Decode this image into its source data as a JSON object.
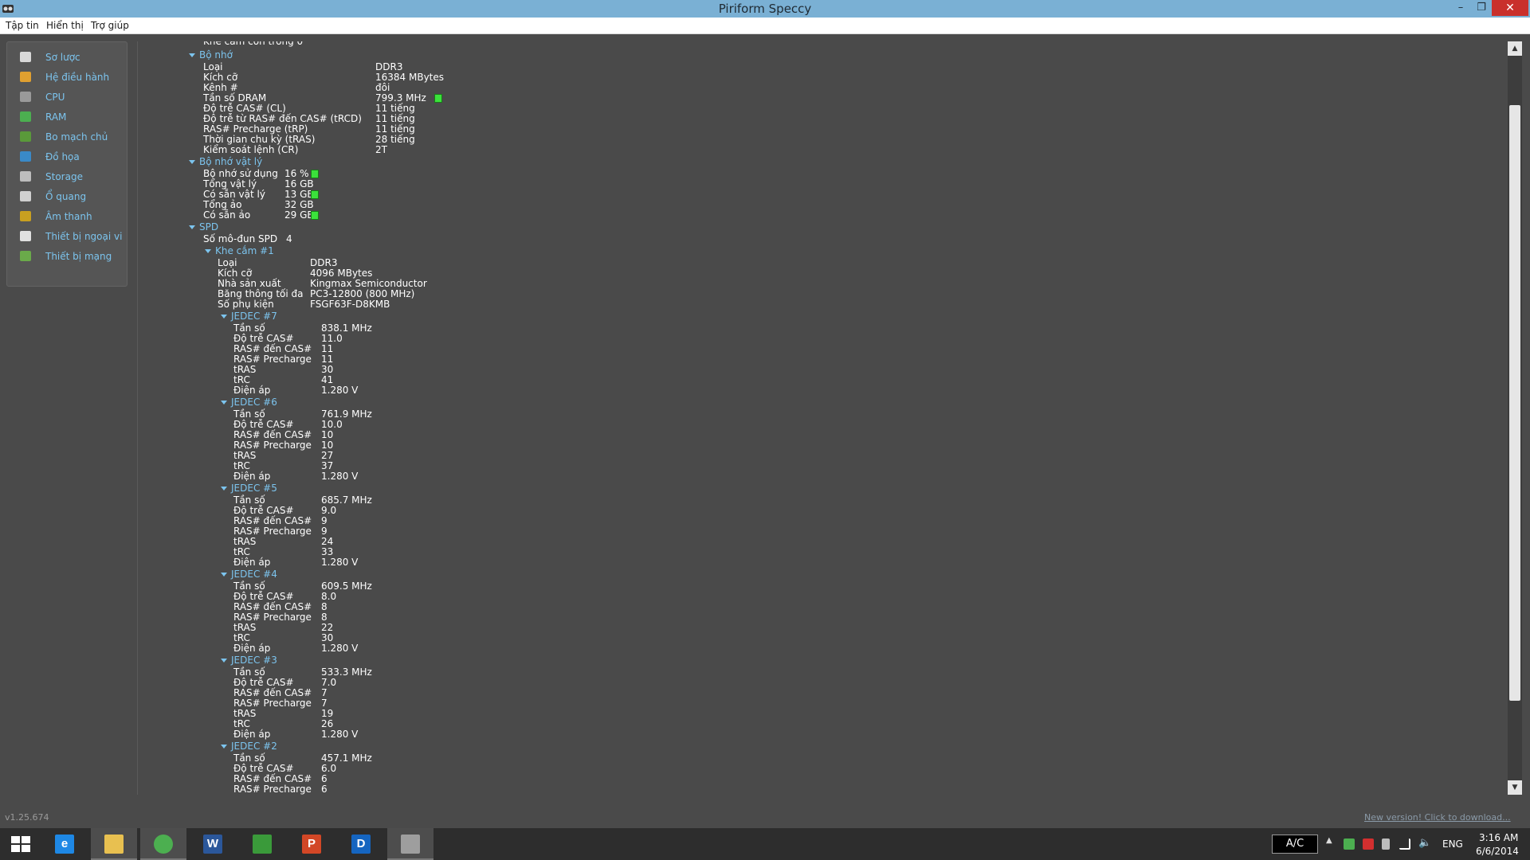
{
  "window": {
    "title": "Piriform Speccy",
    "minimize": "–",
    "maximize": "❐",
    "close": "✕"
  },
  "menu": [
    "Tập tin",
    "Hiển thị",
    "Trợ giúp"
  ],
  "sidebar": [
    {
      "label": "Sơ lược",
      "icon": "summary-icon",
      "color": "#d8d8d8"
    },
    {
      "label": "Hệ điều hành",
      "icon": "windows-icon",
      "color": "#e0a030"
    },
    {
      "label": "CPU",
      "icon": "cpu-icon",
      "color": "#9a9a9a"
    },
    {
      "label": "RAM",
      "icon": "ram-icon",
      "color": "#4caf50"
    },
    {
      "label": "Bo mạch chủ",
      "icon": "motherboard-icon",
      "color": "#5a9a3a"
    },
    {
      "label": "Đồ họa",
      "icon": "graphics-icon",
      "color": "#3a8ac8"
    },
    {
      "label": "Storage",
      "icon": "storage-icon",
      "color": "#bdbdbd"
    },
    {
      "label": "Ổ quang",
      "icon": "optical-drive-icon",
      "color": "#d0d0d0"
    },
    {
      "label": "Âm thanh",
      "icon": "audio-icon",
      "color": "#c8a020"
    },
    {
      "label": "Thiết bị ngoại vi",
      "icon": "peripheral-icon",
      "color": "#e0e0e0"
    },
    {
      "label": "Thiết bị mạng",
      "icon": "network-icon",
      "color": "#6aaa4a"
    }
  ],
  "content": {
    "cut_top": "Khe cắm còn trống   0",
    "memory": {
      "header": "Bộ nhớ",
      "rows": [
        {
          "k": "Loại",
          "v": "DDR3"
        },
        {
          "k": "Kích cỡ",
          "v": "16384 MBytes"
        },
        {
          "k": "Kênh #",
          "v": "đôi"
        },
        {
          "k": "Tần số DRAM",
          "v": "799.3 MHz",
          "ind": true
        },
        {
          "k": "Độ trễ CAS# (CL)",
          "v": "11 tiếng"
        },
        {
          "k": "Độ trễ từ RAS# đến CAS# (tRCD)",
          "v": "11 tiếng"
        },
        {
          "k": "RAS# Precharge (tRP)",
          "v": "11 tiếng"
        },
        {
          "k": "Thời gian chu kỳ (tRAS)",
          "v": "28 tiếng"
        },
        {
          "k": "Kiểm soát lệnh (CR)",
          "v": "2T"
        }
      ]
    },
    "physical": {
      "header": "Bộ nhớ vật lý",
      "rows": [
        {
          "k": "Bộ nhớ sử dụng",
          "v": "16 %",
          "ind": true
        },
        {
          "k": "Tổng vật lý",
          "v": "16 GB"
        },
        {
          "k": "Có sẵn vật lý",
          "v": "13 GB",
          "ind": true
        },
        {
          "k": "Tổng ảo",
          "v": "32 GB"
        },
        {
          "k": "Có sẵn ảo",
          "v": "29 GB",
          "ind": true
        }
      ]
    },
    "spd": {
      "header": "SPD",
      "count_label": "Số mô-đun SPD",
      "count_value": "4",
      "slot": {
        "header": "Khe cắm #1",
        "rows": [
          {
            "k": "Loại",
            "v": "DDR3"
          },
          {
            "k": "Kích cỡ",
            "v": "4096 MBytes"
          },
          {
            "k": "Nhà sản xuất",
            "v": "Kingmax Semiconductor"
          },
          {
            "k": "Băng thông tối đa",
            "v": "PC3-12800 (800 MHz)"
          },
          {
            "k": "Số phụ kiện",
            "v": "FSGF63F-D8KMB"
          }
        ],
        "jedec": [
          {
            "header": "JEDEC #7",
            "rows": [
              {
                "k": "Tần số",
                "v": "838.1 MHz"
              },
              {
                "k": "Độ trễ CAS#",
                "v": "11.0"
              },
              {
                "k": "RAS# đến CAS#",
                "v": "11"
              },
              {
                "k": "RAS# Precharge",
                "v": "11"
              },
              {
                "k": "tRAS",
                "v": "30"
              },
              {
                "k": "tRC",
                "v": "41"
              },
              {
                "k": "Điện áp",
                "v": "1.280 V"
              }
            ]
          },
          {
            "header": "JEDEC #6",
            "rows": [
              {
                "k": "Tần số",
                "v": "761.9 MHz"
              },
              {
                "k": "Độ trễ CAS#",
                "v": "10.0"
              },
              {
                "k": "RAS# đến CAS#",
                "v": "10"
              },
              {
                "k": "RAS# Precharge",
                "v": "10"
              },
              {
                "k": "tRAS",
                "v": "27"
              },
              {
                "k": "tRC",
                "v": "37"
              },
              {
                "k": "Điện áp",
                "v": "1.280 V"
              }
            ]
          },
          {
            "header": "JEDEC #5",
            "rows": [
              {
                "k": "Tần số",
                "v": "685.7 MHz"
              },
              {
                "k": "Độ trễ CAS#",
                "v": "9.0"
              },
              {
                "k": "RAS# đến CAS#",
                "v": "9"
              },
              {
                "k": "RAS# Precharge",
                "v": "9"
              },
              {
                "k": "tRAS",
                "v": "24"
              },
              {
                "k": "tRC",
                "v": "33"
              },
              {
                "k": "Điện áp",
                "v": "1.280 V"
              }
            ]
          },
          {
            "header": "JEDEC #4",
            "rows": [
              {
                "k": "Tần số",
                "v": "609.5 MHz"
              },
              {
                "k": "Độ trễ CAS#",
                "v": "8.0"
              },
              {
                "k": "RAS# đến CAS#",
                "v": "8"
              },
              {
                "k": "RAS# Precharge",
                "v": "8"
              },
              {
                "k": "tRAS",
                "v": "22"
              },
              {
                "k": "tRC",
                "v": "30"
              },
              {
                "k": "Điện áp",
                "v": "1.280 V"
              }
            ]
          },
          {
            "header": "JEDEC #3",
            "rows": [
              {
                "k": "Tần số",
                "v": "533.3 MHz"
              },
              {
                "k": "Độ trễ CAS#",
                "v": "7.0"
              },
              {
                "k": "RAS# đến CAS#",
                "v": "7"
              },
              {
                "k": "RAS# Precharge",
                "v": "7"
              },
              {
                "k": "tRAS",
                "v": "19"
              },
              {
                "k": "tRC",
                "v": "26"
              },
              {
                "k": "Điện áp",
                "v": "1.280 V"
              }
            ]
          },
          {
            "header": "JEDEC #2",
            "rows": [
              {
                "k": "Tần số",
                "v": "457.1 MHz"
              },
              {
                "k": "Độ trễ CAS#",
                "v": "6.0"
              },
              {
                "k": "RAS# đến CAS#",
                "v": "6"
              },
              {
                "k": "RAS# Precharge",
                "v": "6"
              }
            ]
          }
        ]
      }
    }
  },
  "status": {
    "version": "v1.25.674",
    "update_link": "New version! Click to download..."
  },
  "taskbar": {
    "apps": [
      {
        "name": "start-button",
        "icon": "windows-start-icon"
      },
      {
        "name": "internet-explorer",
        "icon": "ie-icon",
        "glyph": "e",
        "color": "#1e88e5"
      },
      {
        "name": "file-explorer",
        "icon": "folder-icon",
        "color": "#e8c050"
      },
      {
        "name": "chrome",
        "icon": "chrome-icon",
        "color": "#4caf50"
      },
      {
        "name": "word",
        "icon": "word-icon",
        "glyph": "W",
        "color": "#2b579a"
      },
      {
        "name": "store",
        "icon": "store-icon",
        "color": "#3a9a3a"
      },
      {
        "name": "powerpoint",
        "icon": "powerpoint-icon",
        "glyph": "P",
        "color": "#d24726"
      },
      {
        "name": "dictionary",
        "icon": "dictionary-icon",
        "glyph": "D",
        "color": "#1565c0"
      },
      {
        "name": "speccy",
        "icon": "speccy-icon",
        "color": "#9e9e9e"
      }
    ],
    "ac_label": "A/C",
    "lang": "ENG",
    "time": "3:16 AM",
    "date": "6/6/2014"
  },
  "colors": {
    "accent": "#7cc4ee",
    "background": "#4a4a4a",
    "indicator": "#3be23b",
    "titlebar": "#7ab0d4"
  }
}
